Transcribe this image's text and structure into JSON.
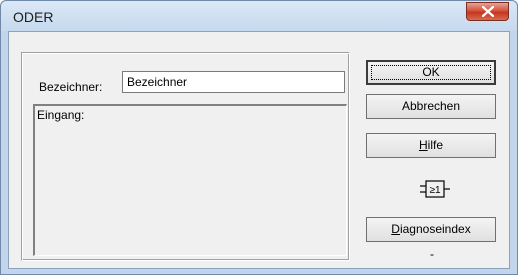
{
  "window": {
    "title": "ODER",
    "close_label": "X"
  },
  "form": {
    "bezeichner_label": "Bezeichner:",
    "bezeichner_value": "Bezeichner",
    "eingang_label": "Eingang:"
  },
  "buttons": {
    "ok": "OK",
    "cancel": "Abbrechen",
    "help_mnemonic": "H",
    "help_rest": "ilfe",
    "diag_mnemonic": "D",
    "diag_rest": "iagnoseindex"
  },
  "gate_symbol": {
    "label": "≥1",
    "icon": "or-gate-icon"
  },
  "diagnose_value": "-"
}
